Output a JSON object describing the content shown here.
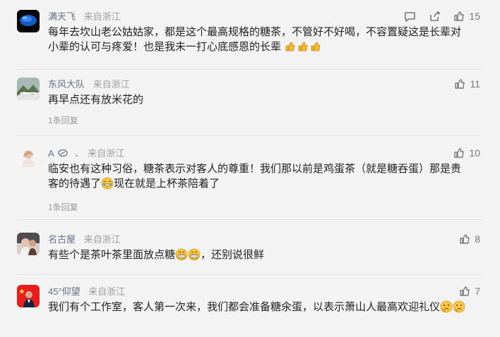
{
  "comments": [
    {
      "user": "满天飞",
      "location": "来自浙江",
      "likes": "15",
      "text_parts": [
        "每年去坎山老公姑姑家，都是这个最高规格的糖茶，不管好不好喝，不容置疑这是长辈对小辈的认可与疼爱！也是我未一打心底感恩的长辈"
      ],
      "icons": [
        "comment-icon",
        "share-icon",
        "thumbs-up-icon"
      ]
    },
    {
      "user": "东风大队",
      "location": "来自浙江",
      "likes": "11",
      "text": "再早点还有放米花的",
      "replies": "1条回复"
    },
    {
      "user": "A",
      "location": "来自浙江",
      "likes": "10",
      "text_parts": [
        "临安也有这种习俗，糖茶表示对客人的尊重！我们那以前是鸡蛋茶（就是糖吞蛋）那是贵客的待遇了",
        "现在就是上杯茶陪着了"
      ],
      "replies": "1条回复"
    },
    {
      "user": "名古屋",
      "location": "来自浙江",
      "likes": "8",
      "text_parts": [
        "有些个是茶叶茶里面放点糖",
        "，还别说很鲜"
      ]
    },
    {
      "user": "45°仰望",
      "location": "来自浙江",
      "likes": "7",
      "text_parts": [
        "我们有个工作室，客人第一次来，我们都会准备糖氽蛋，以表示萧山人最高欢迎礼仪"
      ]
    }
  ],
  "colors": {
    "background": "#f3f3f3",
    "text": "#222222",
    "username": "#667086",
    "meta": "#9c9c9c",
    "thumbs_up_emoji": "#f5b935"
  }
}
